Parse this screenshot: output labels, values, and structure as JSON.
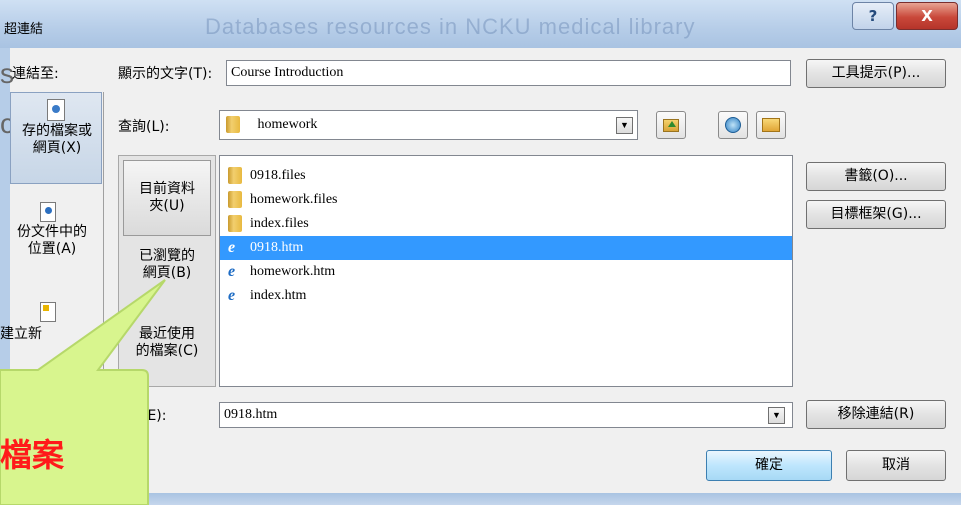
{
  "window": {
    "title": "超連結",
    "blurred_title": "Databases resources in NCKU medical library",
    "help_glyph": "?",
    "close_glyph": "X"
  },
  "link_to": {
    "label": "連結至:",
    "items": [
      {
        "label": "存的檔案或\n網頁(X)",
        "icon": "web-page-icon"
      },
      {
        "label": "份文件中的\n位置(A)",
        "icon": "document-place-icon"
      },
      {
        "label": "建立新",
        "icon": "new-document-icon"
      }
    ]
  },
  "left_cutoff": {
    "line1": "s",
    "line2": "c"
  },
  "display_text": {
    "label": "顯示的文字(T):",
    "value": "Course Introduction",
    "screentip_button": "工具提示(P)..."
  },
  "look_in": {
    "label": "查詢(L):",
    "value": "homework",
    "icons": [
      "up-folder-icon",
      "browse-web-icon",
      "browse-file-icon"
    ]
  },
  "places": [
    {
      "label": "目前資料\n夾(U)"
    },
    {
      "label": "已瀏覽的\n網頁(B)"
    },
    {
      "label": "最近使用\n的檔案(C)"
    }
  ],
  "files": [
    {
      "name": "0918.files",
      "type": "folder",
      "selected": false
    },
    {
      "name": "homework.files",
      "type": "folder",
      "selected": false
    },
    {
      "name": "index.files",
      "type": "folder",
      "selected": false
    },
    {
      "name": "0918.htm",
      "type": "html",
      "selected": true
    },
    {
      "name": "homework.htm",
      "type": "html",
      "selected": false
    },
    {
      "name": "index.htm",
      "type": "html",
      "selected": false
    }
  ],
  "right_buttons": {
    "bookmark": "書籤(O)...",
    "target_frame": "目標框架(G)...",
    "remove_link": "移除連結(R)"
  },
  "address": {
    "label": "址(E):",
    "value": "0918.htm"
  },
  "footer": {
    "ok": "確定",
    "cancel": "取消"
  },
  "callout": {
    "text": "檔案",
    "bg_color": "#d8f58e",
    "text_color": "#ff1a1a"
  }
}
